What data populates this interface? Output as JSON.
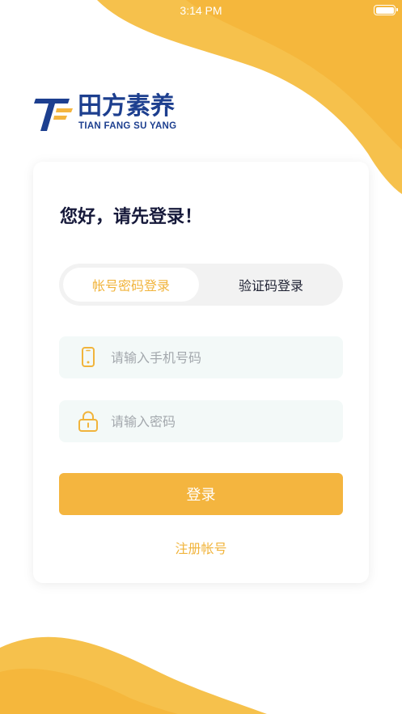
{
  "status_bar": {
    "time": "3:14 PM"
  },
  "logo": {
    "chinese_name": "田方素养",
    "english_name": "TIAN FANG SU YANG"
  },
  "login_card": {
    "greeting": "您好，请先登录！",
    "tabs": [
      {
        "label": "帐号密码登录",
        "active": true
      },
      {
        "label": "验证码登录",
        "active": false
      }
    ],
    "phone_field": {
      "icon": "phone-icon",
      "placeholder": "请输入手机号码",
      "value": ""
    },
    "password_field": {
      "icon": "lock-icon",
      "placeholder": "请输入密码",
      "value": ""
    },
    "login_button": {
      "label": "登录"
    },
    "register_link": {
      "label": "注册帐号"
    }
  },
  "colors": {
    "accent": "#f4b53f",
    "brand_blue": "#1d3f8f",
    "input_background": "#f3f9f8",
    "tab_background": "#f2f2f2"
  }
}
